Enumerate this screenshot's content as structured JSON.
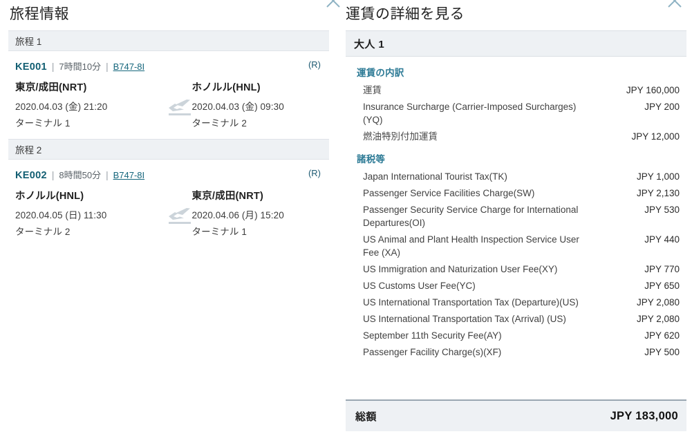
{
  "itinerary_panel": {
    "title": "旅程情報",
    "close_label": "×",
    "segments": [
      {
        "header": "旅程 1",
        "flight_no": "KE001",
        "duration": "7時間10分",
        "equipment": "B747-8I",
        "separator": "|",
        "badge": "(R)",
        "from": {
          "city": "東京/成田(NRT)",
          "datetime": "2020.04.03 (金) 21:20",
          "terminal": "ターミナル 1"
        },
        "to": {
          "city": "ホノルル(HNL)",
          "datetime": "2020.04.03 (金) 09:30",
          "terminal": "ターミナル 2"
        }
      },
      {
        "header": "旅程 2",
        "flight_no": "KE002",
        "duration": "8時間50分",
        "equipment": "B747-8I",
        "separator": "|",
        "badge": "(R)",
        "from": {
          "city": "ホノルル(HNL)",
          "datetime": "2020.04.05 (日) 11:30",
          "terminal": "ターミナル 2"
        },
        "to": {
          "city": "東京/成田(NRT)",
          "datetime": "2020.04.06 (月) 15:20",
          "terminal": "ターミナル 1"
        }
      }
    ]
  },
  "fare_panel": {
    "title": "運賃の詳細を見る",
    "close_label": "×",
    "passenger_header": "大人 1",
    "fare_section_title": "運賃の内訳",
    "fare_items": [
      {
        "label": "運賃",
        "amount": "JPY 160,000"
      },
      {
        "label": "Insurance Surcharge (Carrier-Imposed Surcharges)(YQ)",
        "amount": "JPY 200"
      },
      {
        "label": "燃油特別付加運賃",
        "amount": "JPY 12,000"
      }
    ],
    "tax_section_title": "諸税等",
    "tax_items": [
      {
        "label": "Japan International Tourist Tax(TK)",
        "amount": "JPY 1,000"
      },
      {
        "label": "Passenger Service Facilities Charge(SW)",
        "amount": "JPY 2,130"
      },
      {
        "label": "Passenger Security Service Charge for International Departures(OI)",
        "amount": "JPY 530"
      },
      {
        "label": "US Animal and Plant Health Inspection Service User Fee (XA)",
        "amount": "JPY 440"
      },
      {
        "label": "US Immigration and Naturization User Fee(XY)",
        "amount": "JPY 770"
      },
      {
        "label": "US Customs User Fee(YC)",
        "amount": "JPY 650"
      },
      {
        "label": "US International Transportation Tax (Departure)(US)",
        "amount": "JPY 2,080"
      },
      {
        "label": "US International Transportation Tax (Arrival) (US)",
        "amount": "JPY 2,080"
      },
      {
        "label": "September 11th Security Fee(AY)",
        "amount": "JPY 620"
      },
      {
        "label": "Passenger Facility Charge(s)(XF)",
        "amount": "JPY 500"
      }
    ],
    "total_label": "総額",
    "total_amount": "JPY 183,000"
  },
  "icons": {
    "close": "close-icon",
    "plane": "airplane-takeoff-icon"
  },
  "colors": {
    "accent_teal": "#2e7b96",
    "flight_no": "#115e72",
    "header_bg": "#eef1f4",
    "close_icon": "#8fb3c4"
  }
}
